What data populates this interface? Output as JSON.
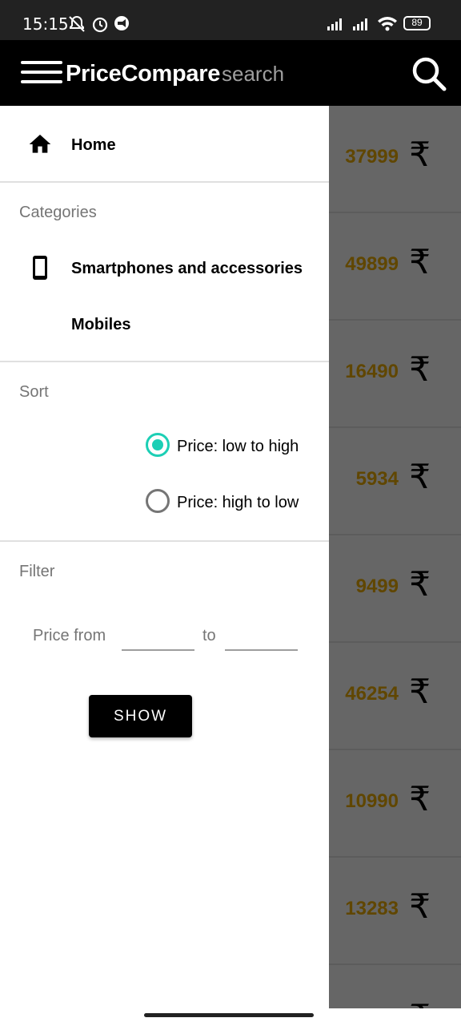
{
  "status_bar": {
    "time": "15:15",
    "battery": "89"
  },
  "app_bar": {
    "title": "PriceCompare",
    "search_placeholder": "search"
  },
  "drawer": {
    "home_label": "Home",
    "categories_title": "Categories",
    "category_items": [
      "Smartphones and accessories",
      "Mobiles"
    ],
    "sort_title": "Sort",
    "sort_options": [
      {
        "label": "Price: low to high",
        "selected": true
      },
      {
        "label": "Price: high to low",
        "selected": false
      }
    ],
    "filter_title": "Filter",
    "price_from_label": "Price from",
    "to_label": "to",
    "price_from_value": "",
    "price_to_value": "",
    "show_button": "SHOW"
  },
  "background_prices": [
    "37999",
    "49899",
    "16490",
    "5934",
    "9499",
    "46254",
    "10990",
    "13283"
  ],
  "currency_symbol": "₹",
  "colors": {
    "accent": "#1ccfb5",
    "price": "#f0b000",
    "app_bar": "#000000"
  }
}
